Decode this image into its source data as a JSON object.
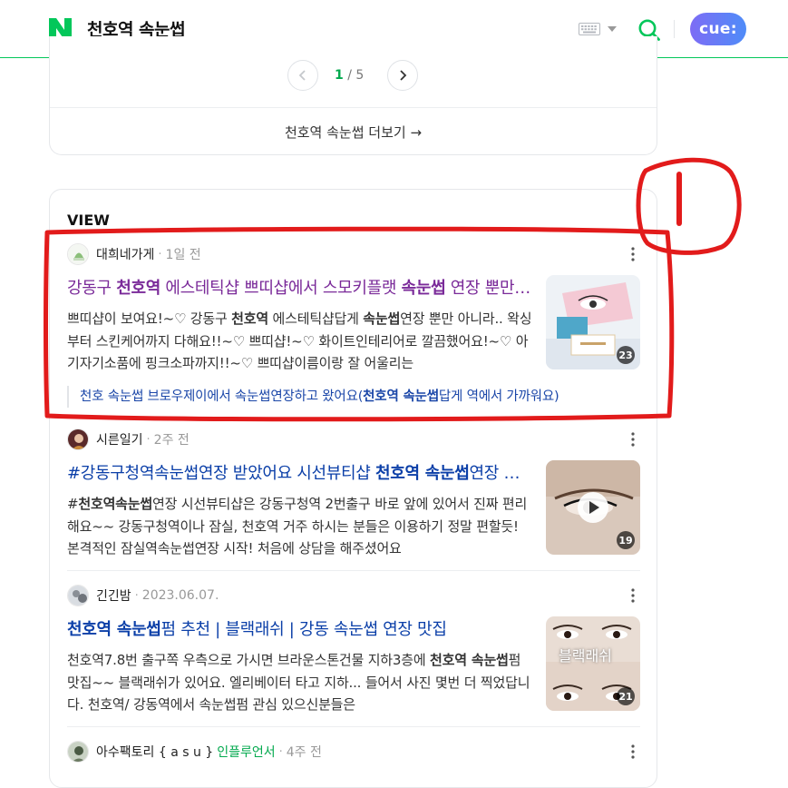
{
  "header": {
    "query": "천호역 속눈썹",
    "cue_label": "cue:"
  },
  "pagination": {
    "current": "1",
    "separator": "/",
    "total": "5",
    "more_label": "천호역 속눈썹 더보기 →"
  },
  "view": {
    "section_title": "VIEW",
    "items": [
      {
        "author": "대희네가게",
        "time": "1일 전",
        "title_parts": [
          "강동구 ",
          "천호역",
          " 에스테틱샵 쁘띠샵에서 스모키플랫 ",
          "속눈썹",
          " 연장 뿐만 아니라"
        ],
        "desc_parts": [
          "쁘띠샵이 보여요!~♡ 강동구 ",
          "천호역",
          " 에스테틱샵답게 ",
          "속눈썹",
          "연장 뿐만 아니라.. 왁싱부터 스킨케어까지 다해요!!~♡ 쁘띠샵!~♡ 화이트인테리어로 깔끔했어요!~♡ 아기자기소품에 핑크소파까지!!~♡ 쁘띠샵이름이랑 잘 어울리는"
        ],
        "image_count": "23",
        "sub_link_parts": [
          "천호 속눈썹 브로우제이에서 속눈썹연장하고 왔어요(",
          "천호역 속눈썹",
          "답게 역에서 가까워요)"
        ]
      },
      {
        "author": "시른일기",
        "time": "2주 전",
        "title_parts": [
          "#강동구청역속눈썹연장 받았어요 시선뷰티샵 ",
          "천호역 속눈썹",
          "연장 잘하는곳"
        ],
        "desc_parts": [
          "#",
          "천호역속눈썹",
          "연장 시선뷰티샵은 강동구청역 2번출구 바로 앞에 있어서 진짜 편리해요~~ 강동구청역이나 잠실, 천호역 거주 하시는 분들은 이용하기 정말 편할듯! 본격적인 잠실역속눈썹연장 시작! 처음에 상담을 해주셨어요"
        ],
        "image_count": "19"
      },
      {
        "author": "긴긴밤",
        "time": "2023.06.07.",
        "title_parts": [
          "",
          "천호역 속눈썹",
          "펌 추천 | 블랙래쉬 | 강동 속눈썹 연장 맛집"
        ],
        "desc_parts": [
          "천호역7.8번 출구쪽 우측으로 가시면 브라운스톤건물 지하3층에 ",
          "천호역 속눈썹",
          "펌 맛집~~ 블랙래쉬가 있어요. 엘리베이터 타고 지하... 들어서 사진 몇번 더 찍었답니다. 천호역/ 강동역에서 속눈썹펌 관심 있으신분들은"
        ],
        "image_count": "21",
        "thumb_text": "블랙래쉬"
      },
      {
        "author": "아수팩토리 { a s u }",
        "influencer": "인플루언서",
        "time": "4주 전"
      }
    ]
  },
  "colors": {
    "brand_green": "#03c75a",
    "link_blue": "#0b3fa8",
    "visited_purple": "#7a2a99",
    "annotation_red": "#e21b1b"
  }
}
